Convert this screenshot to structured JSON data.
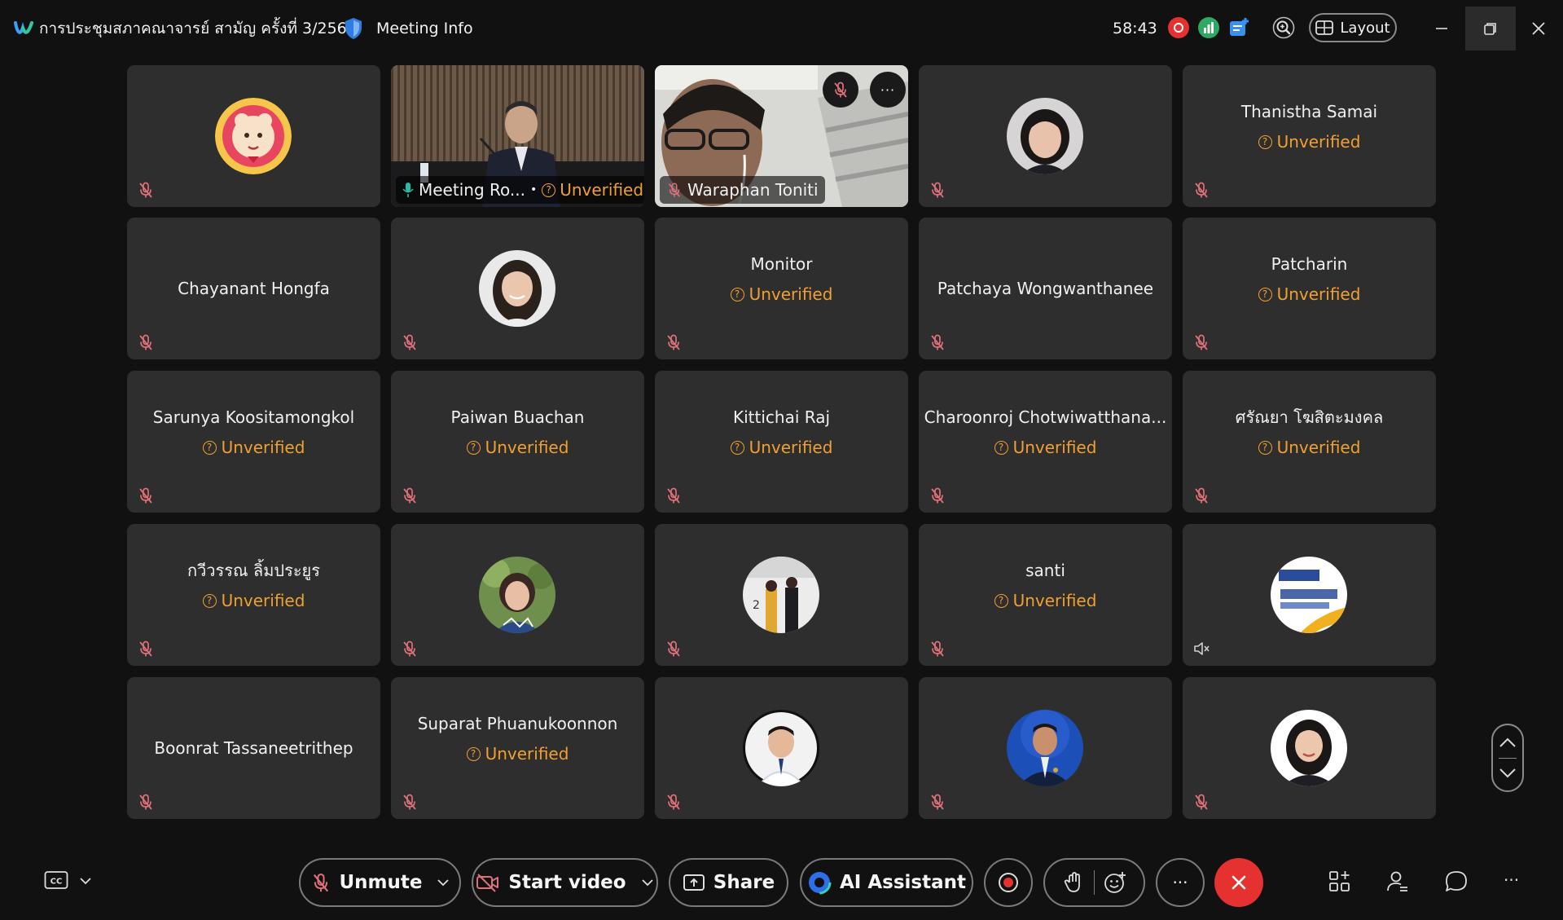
{
  "titlebar": {
    "meeting_title": "การประชุมสภาคณาจารย์ สามัญ ครั้งที่ 3/2569",
    "meeting_info": "Meeting Info",
    "timer": "58:43",
    "layout_label": "Layout"
  },
  "unverified_label": "Unverified",
  "tiles": {
    "r1c2": {
      "name": "Meeting Ro...",
      "sep": "•"
    },
    "r1c3": {
      "name": "Waraphan Toniti"
    },
    "r1c5": {
      "name": "Thanistha  Samai"
    },
    "r2c1": {
      "name": "Chayanant Hongfa"
    },
    "r2c3": {
      "name": "Monitor"
    },
    "r2c4": {
      "name": "Patchaya Wongwanthanee"
    },
    "r2c5": {
      "name": "Patcharin"
    },
    "r3c1": {
      "name": "Sarunya Koositamongkol"
    },
    "r3c2": {
      "name": "Paiwan Buachan"
    },
    "r3c3": {
      "name": "Kittichai Raj"
    },
    "r3c4": {
      "name": "Charoonroj Chotwiwatthana..."
    },
    "r3c5": {
      "name": "ศรัณยา โฆสิตะมงคล"
    },
    "r4c1": {
      "name": "กวีวรรณ ลิ้มประยูร"
    },
    "r4c4": {
      "name": "santi"
    },
    "r5c1": {
      "name": "Boonrat Tassaneetrithep"
    },
    "r5c2": {
      "name": "Suparat Phuanukoonnon"
    }
  },
  "toolbar": {
    "unmute_label": "Unmute",
    "start_video_label": "Start video",
    "share_label": "Share",
    "ai_assistant_label": "AI Assistant",
    "more_label": "···"
  },
  "colors": {
    "unverified": "#f0a030",
    "mute_icon": "#e0707a",
    "active_speaker": "#2fb8a6",
    "end_call": "#e5312f",
    "tile_bg": "#2e2e2e"
  }
}
